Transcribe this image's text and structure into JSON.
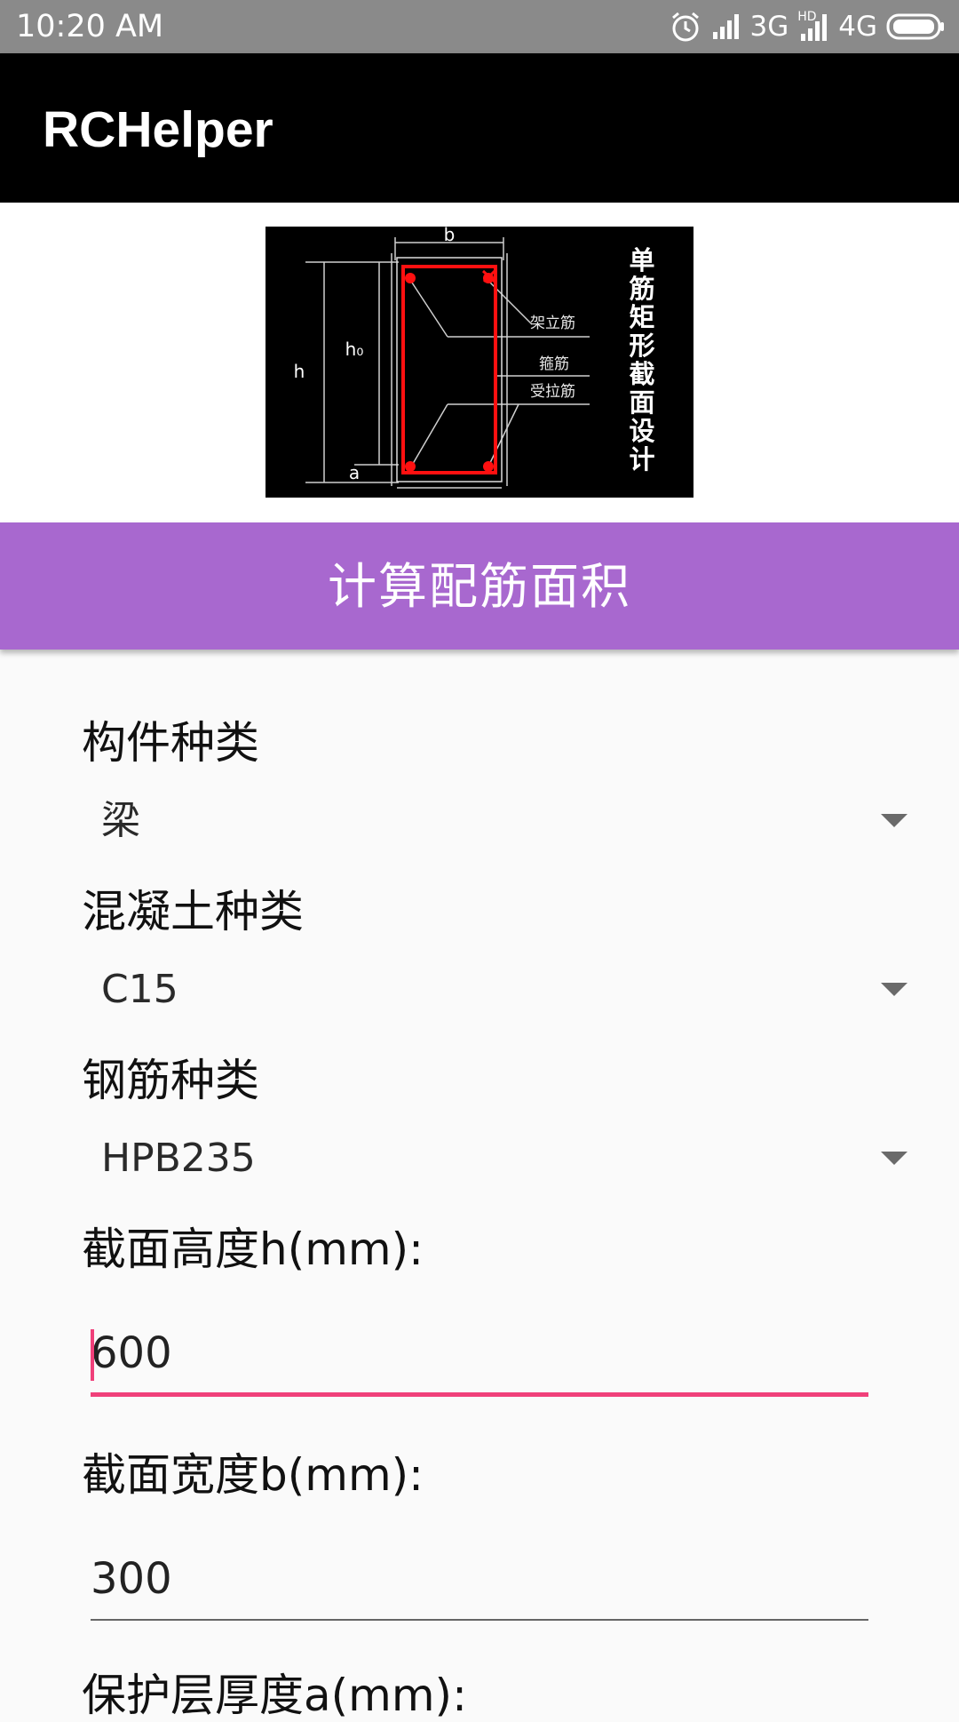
{
  "status_bar": {
    "time": "10:20 AM",
    "network_3g": "3G",
    "network_4g": "4G",
    "hd_label": "HD"
  },
  "app_bar": {
    "title": "RCHelper"
  },
  "diagram": {
    "b": "b",
    "h": "h",
    "h0": "h₀",
    "a": "a",
    "label_erection_bar": "架立筋",
    "label_stirrup": "箍筋",
    "label_tension_bar": "受拉筋",
    "vertical_title": [
      "单",
      "筋",
      "矩",
      "形",
      "截",
      "面",
      "设",
      "计"
    ]
  },
  "calc_button": {
    "label": "计算配筋面积"
  },
  "form": {
    "member_type": {
      "label": "构件种类",
      "value": "梁"
    },
    "concrete_type": {
      "label": "混凝土种类",
      "value": "C15"
    },
    "rebar_type": {
      "label": "钢筋种类",
      "value": "HPB235"
    },
    "section_height": {
      "label": "截面高度h(mm):",
      "value": "600"
    },
    "section_width": {
      "label": "截面宽度b(mm):",
      "value": "300"
    },
    "cover_thickness": {
      "label": "保护层厚度a(mm):"
    }
  },
  "colors": {
    "status_bar": "#8a8a8a",
    "app_bar": "#000000",
    "calc_button": "#a868cf",
    "accent": "#f0407a",
    "rebar_red": "#ff1010"
  }
}
